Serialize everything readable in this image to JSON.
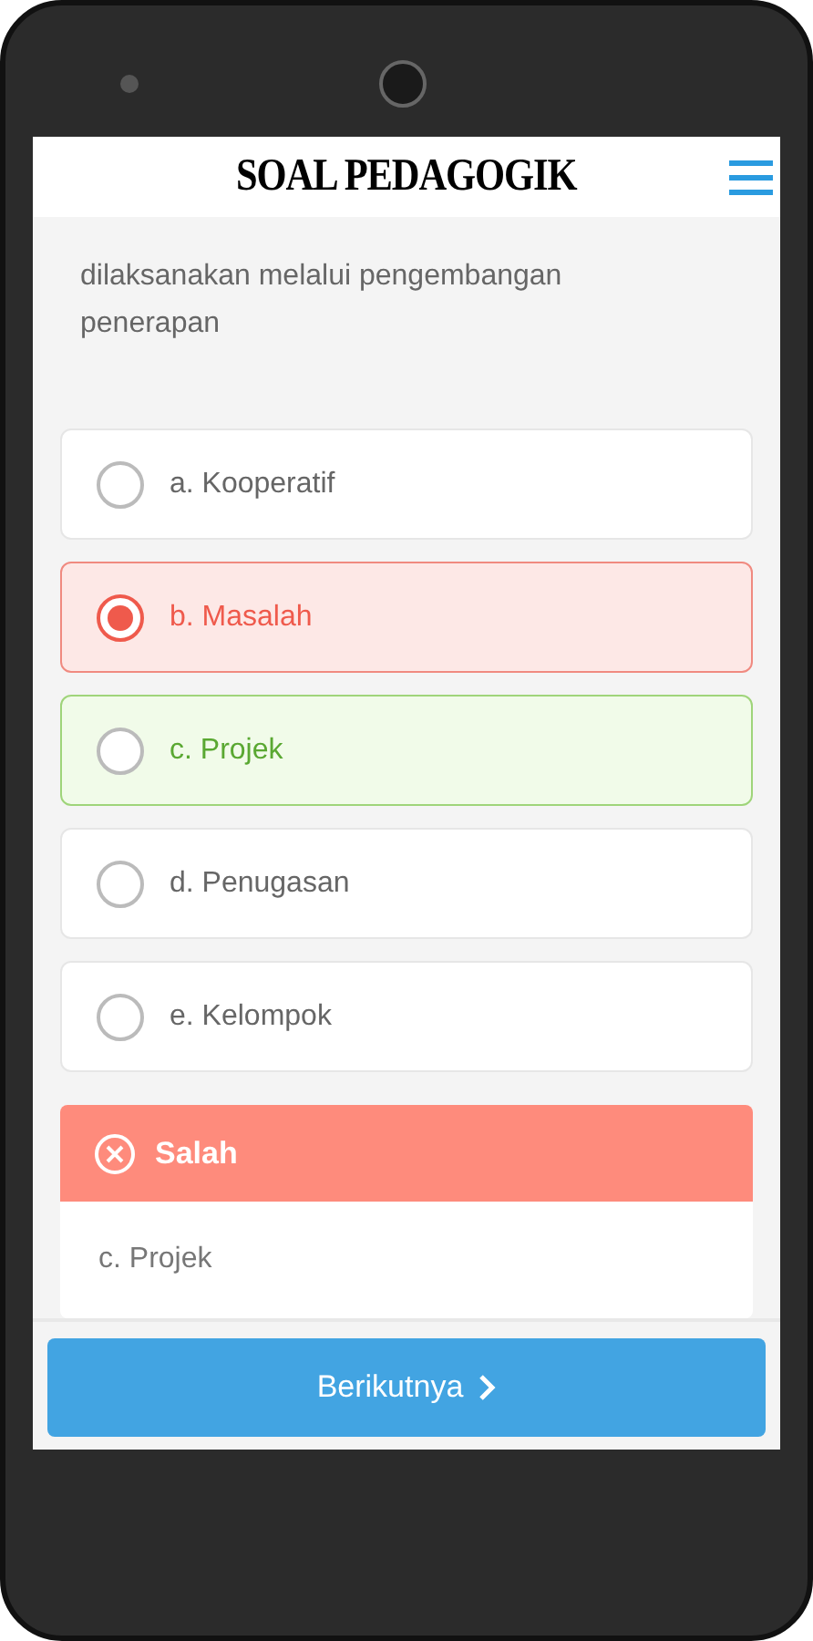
{
  "header": {
    "title": "SOAL PEDAGOGIK"
  },
  "question": {
    "text": "dilaksanakan melalui pengembangan penerapan"
  },
  "options": [
    {
      "label": "a. Kooperatif",
      "selected": false,
      "kind": "plain"
    },
    {
      "label": "b. Masalah",
      "selected": true,
      "kind": "wrong"
    },
    {
      "label": "c. Projek",
      "selected": false,
      "kind": "correct"
    },
    {
      "label": "d. Penugasan",
      "selected": false,
      "kind": "plain"
    },
    {
      "label": "e. Kelompok",
      "selected": false,
      "kind": "plain"
    }
  ],
  "feedback": {
    "kind": "wrong",
    "title": "Salah",
    "answer": "c. Projek"
  },
  "next_button": {
    "label": "Berikutnya"
  }
}
